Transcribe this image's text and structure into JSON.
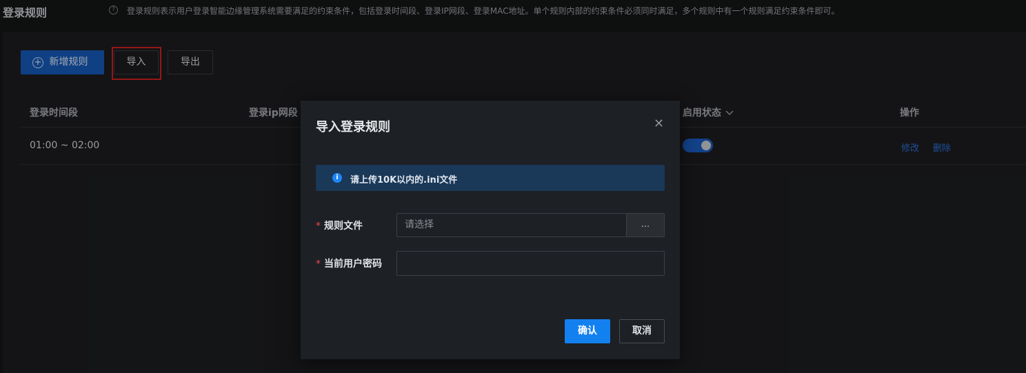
{
  "header": {
    "title": "登录规则",
    "description": "登录规则表示用户登录智能边缘管理系统需要满足的约束条件，包括登录时间段、登录IP网段、登录MAC地址。单个规则内部的约束条件必须同时满足，多个规则中有一个规则满足约束条件即可。"
  },
  "toolbar": {
    "add_label": "新增规则",
    "import_label": "导入",
    "export_label": "导出"
  },
  "table": {
    "columns": [
      "登录时间段",
      "登录ip网段",
      "启用状态",
      "操作"
    ],
    "rows": [
      {
        "time": "01:00 ~ 02:00",
        "enabled": true,
        "edit": "修改",
        "delete": "删除"
      }
    ]
  },
  "dialog": {
    "title": "导入登录规则",
    "notice": "请上传10K以内的.ini文件",
    "file_label": "规则文件",
    "file_placeholder": "请选择",
    "browse_label": "...",
    "password_label": "当前用户密码",
    "password_value": "",
    "confirm_label": "确认",
    "cancel_label": "取消"
  },
  "colors": {
    "primary": "#1380f0",
    "required": "#e5484d",
    "highlight": "#d0201e",
    "link": "#2a6fd6"
  }
}
